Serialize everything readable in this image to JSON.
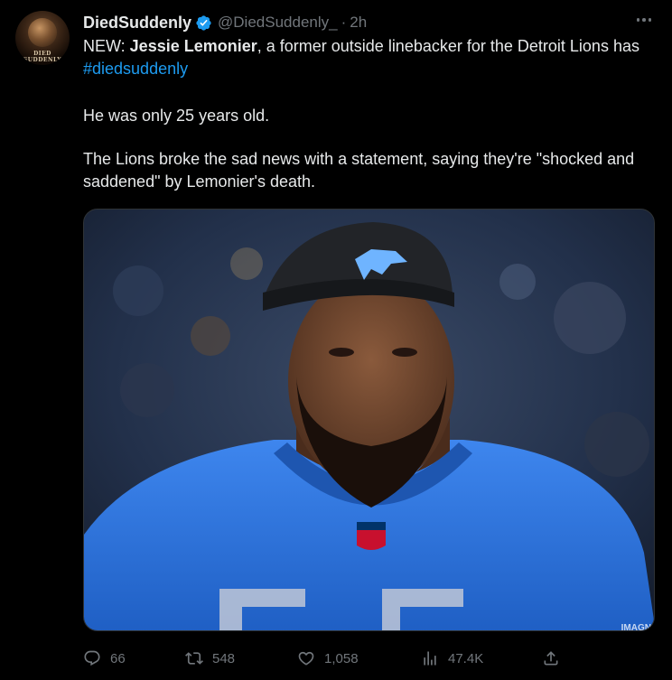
{
  "tweet": {
    "author": {
      "display_name": "DiedSuddenly",
      "handle": "@DiedSuddenly_",
      "time_sep": "·",
      "time": "2h",
      "verified": true,
      "avatar_text": "DIED SUDDENLY"
    },
    "body": {
      "line1_prefix": "NEW: ",
      "line1_bold": "Jessie Lemonier",
      "line1_rest": ", a former outside linebacker for the Detroit Lions has ",
      "hashtag": "#diedsuddenly",
      "line2": "He was only 25 years old.",
      "line3": "The Lions broke the sad news with a statement, saying they're \"shocked and saddened\" by Lemonier's death."
    },
    "media": {
      "watermark": "IMAGN"
    },
    "actions": {
      "replies": "66",
      "retweets": "548",
      "likes": "1,058",
      "views": "47.4K"
    }
  },
  "colors": {
    "background": "#000000",
    "text": "#e7e9ea",
    "muted": "#71767b",
    "link": "#1d9bf0",
    "verified": "#1d9bf0",
    "jersey": "#2a6fd6"
  },
  "icons": {
    "verified": "verified-badge-icon",
    "more": "more-icon",
    "reply": "reply-icon",
    "retweet": "retweet-icon",
    "like": "like-icon",
    "views": "views-icon",
    "share": "share-icon"
  }
}
